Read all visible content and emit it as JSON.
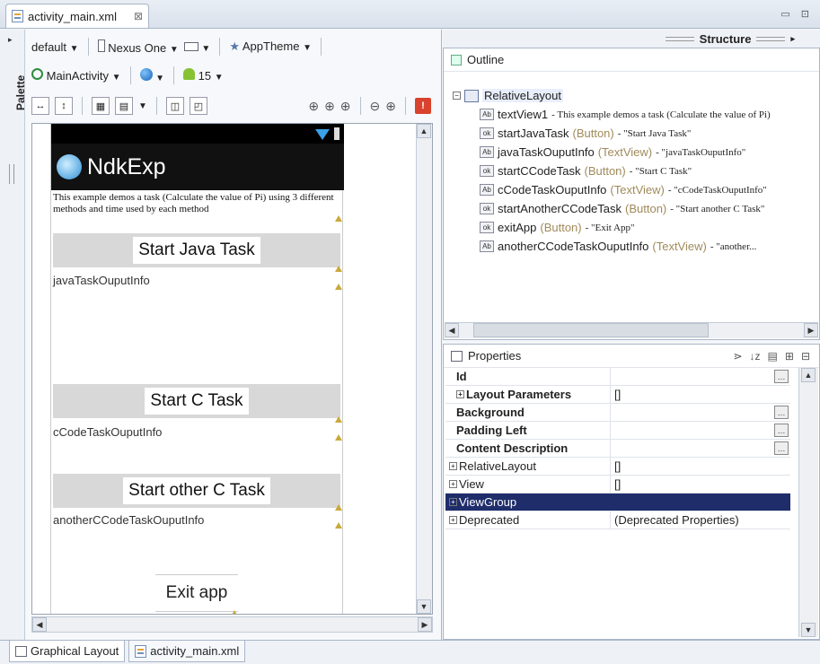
{
  "editor": {
    "file_tab": "activity_main.xml",
    "close_glyph": "⊠",
    "window_buttons": [
      "▭",
      "⊡"
    ]
  },
  "palette": {
    "label": "Palette"
  },
  "toolbar": {
    "config": "default",
    "device": "Nexus One",
    "theme": "AppTheme",
    "activity": "MainActivity",
    "api_level": "15"
  },
  "device_preview": {
    "app_title": "NdkExp",
    "description": "This example demos a task (Calculate the value of Pi) using 3 different methods and time used by each method",
    "buttons": {
      "start_java": "Start Java Task",
      "start_c": "Start C Task",
      "start_other_c": "Start other C Task",
      "exit": "Exit app"
    },
    "textviews": {
      "java_output": "javaTaskOuputInfo",
      "c_output": "cCodeTaskOuputInfo",
      "other_c_output": "anotherCCodeTaskOuputInfo"
    }
  },
  "structure": {
    "header": "Structure",
    "outline_title": "Outline",
    "root": "RelativeLayout",
    "children": [
      {
        "icon": "Ab",
        "name": "textView1",
        "type": "",
        "text": "- This example demos a task (Calculate the value of Pi)"
      },
      {
        "icon": "ok",
        "name": "startJavaTask",
        "type": "(Button)",
        "text": "- \"Start Java Task\""
      },
      {
        "icon": "Ab",
        "name": "javaTaskOuputInfo",
        "type": "(TextView)",
        "text": "- \"javaTaskOuputInfo\""
      },
      {
        "icon": "ok",
        "name": "startCCodeTask",
        "type": "(Button)",
        "text": "- \"Start C Task\""
      },
      {
        "icon": "Ab",
        "name": "cCodeTaskOuputInfo",
        "type": "(TextView)",
        "text": "- \"cCodeTaskOuputInfo\""
      },
      {
        "icon": "ok",
        "name": "startAnotherCCodeTask",
        "type": "(Button)",
        "text": "- \"Start another C Task\""
      },
      {
        "icon": "ok",
        "name": "exitApp",
        "type": "(Button)",
        "text": "- \"Exit App\""
      },
      {
        "icon": "Ab",
        "name": "anotherCCodeTaskOuputInfo",
        "type": "(TextView)",
        "text": "- \"another..."
      }
    ]
  },
  "properties": {
    "title": "Properties",
    "rows": [
      {
        "name": "Id",
        "value": "",
        "bold": true,
        "expand": false,
        "check": false,
        "ellipsis": true,
        "selected": false
      },
      {
        "name": "Layout Parameters",
        "value": "[]",
        "bold": true,
        "expand": true,
        "check": false,
        "ellipsis": false,
        "selected": false
      },
      {
        "name": "Background",
        "value": "",
        "bold": true,
        "expand": false,
        "check": false,
        "ellipsis": true,
        "selected": false
      },
      {
        "name": "Padding Left",
        "value": "",
        "bold": true,
        "expand": false,
        "check": false,
        "ellipsis": true,
        "selected": false
      },
      {
        "name": "Content Description",
        "value": "",
        "bold": true,
        "expand": false,
        "check": false,
        "ellipsis": true,
        "selected": false
      },
      {
        "name": "RelativeLayout",
        "value": "[]",
        "bold": false,
        "expand": true,
        "check": false,
        "ellipsis": false,
        "selected": false
      },
      {
        "name": "View",
        "value": "[]",
        "bold": false,
        "expand": true,
        "check": false,
        "ellipsis": false,
        "selected": false
      },
      {
        "name": "ViewGroup",
        "value": "",
        "bold": false,
        "expand": true,
        "check": false,
        "ellipsis": false,
        "selected": true
      },
      {
        "name": "Deprecated",
        "value": "(Deprecated Properties)",
        "bold": false,
        "expand": true,
        "check": false,
        "ellipsis": false,
        "selected": false
      }
    ]
  },
  "bottom_tabs": [
    "Graphical Layout",
    "activity_main.xml"
  ],
  "colors": {
    "selection": "#1f2d6b",
    "action_bar": "#111111",
    "button_bg": "#d8d8d8"
  }
}
